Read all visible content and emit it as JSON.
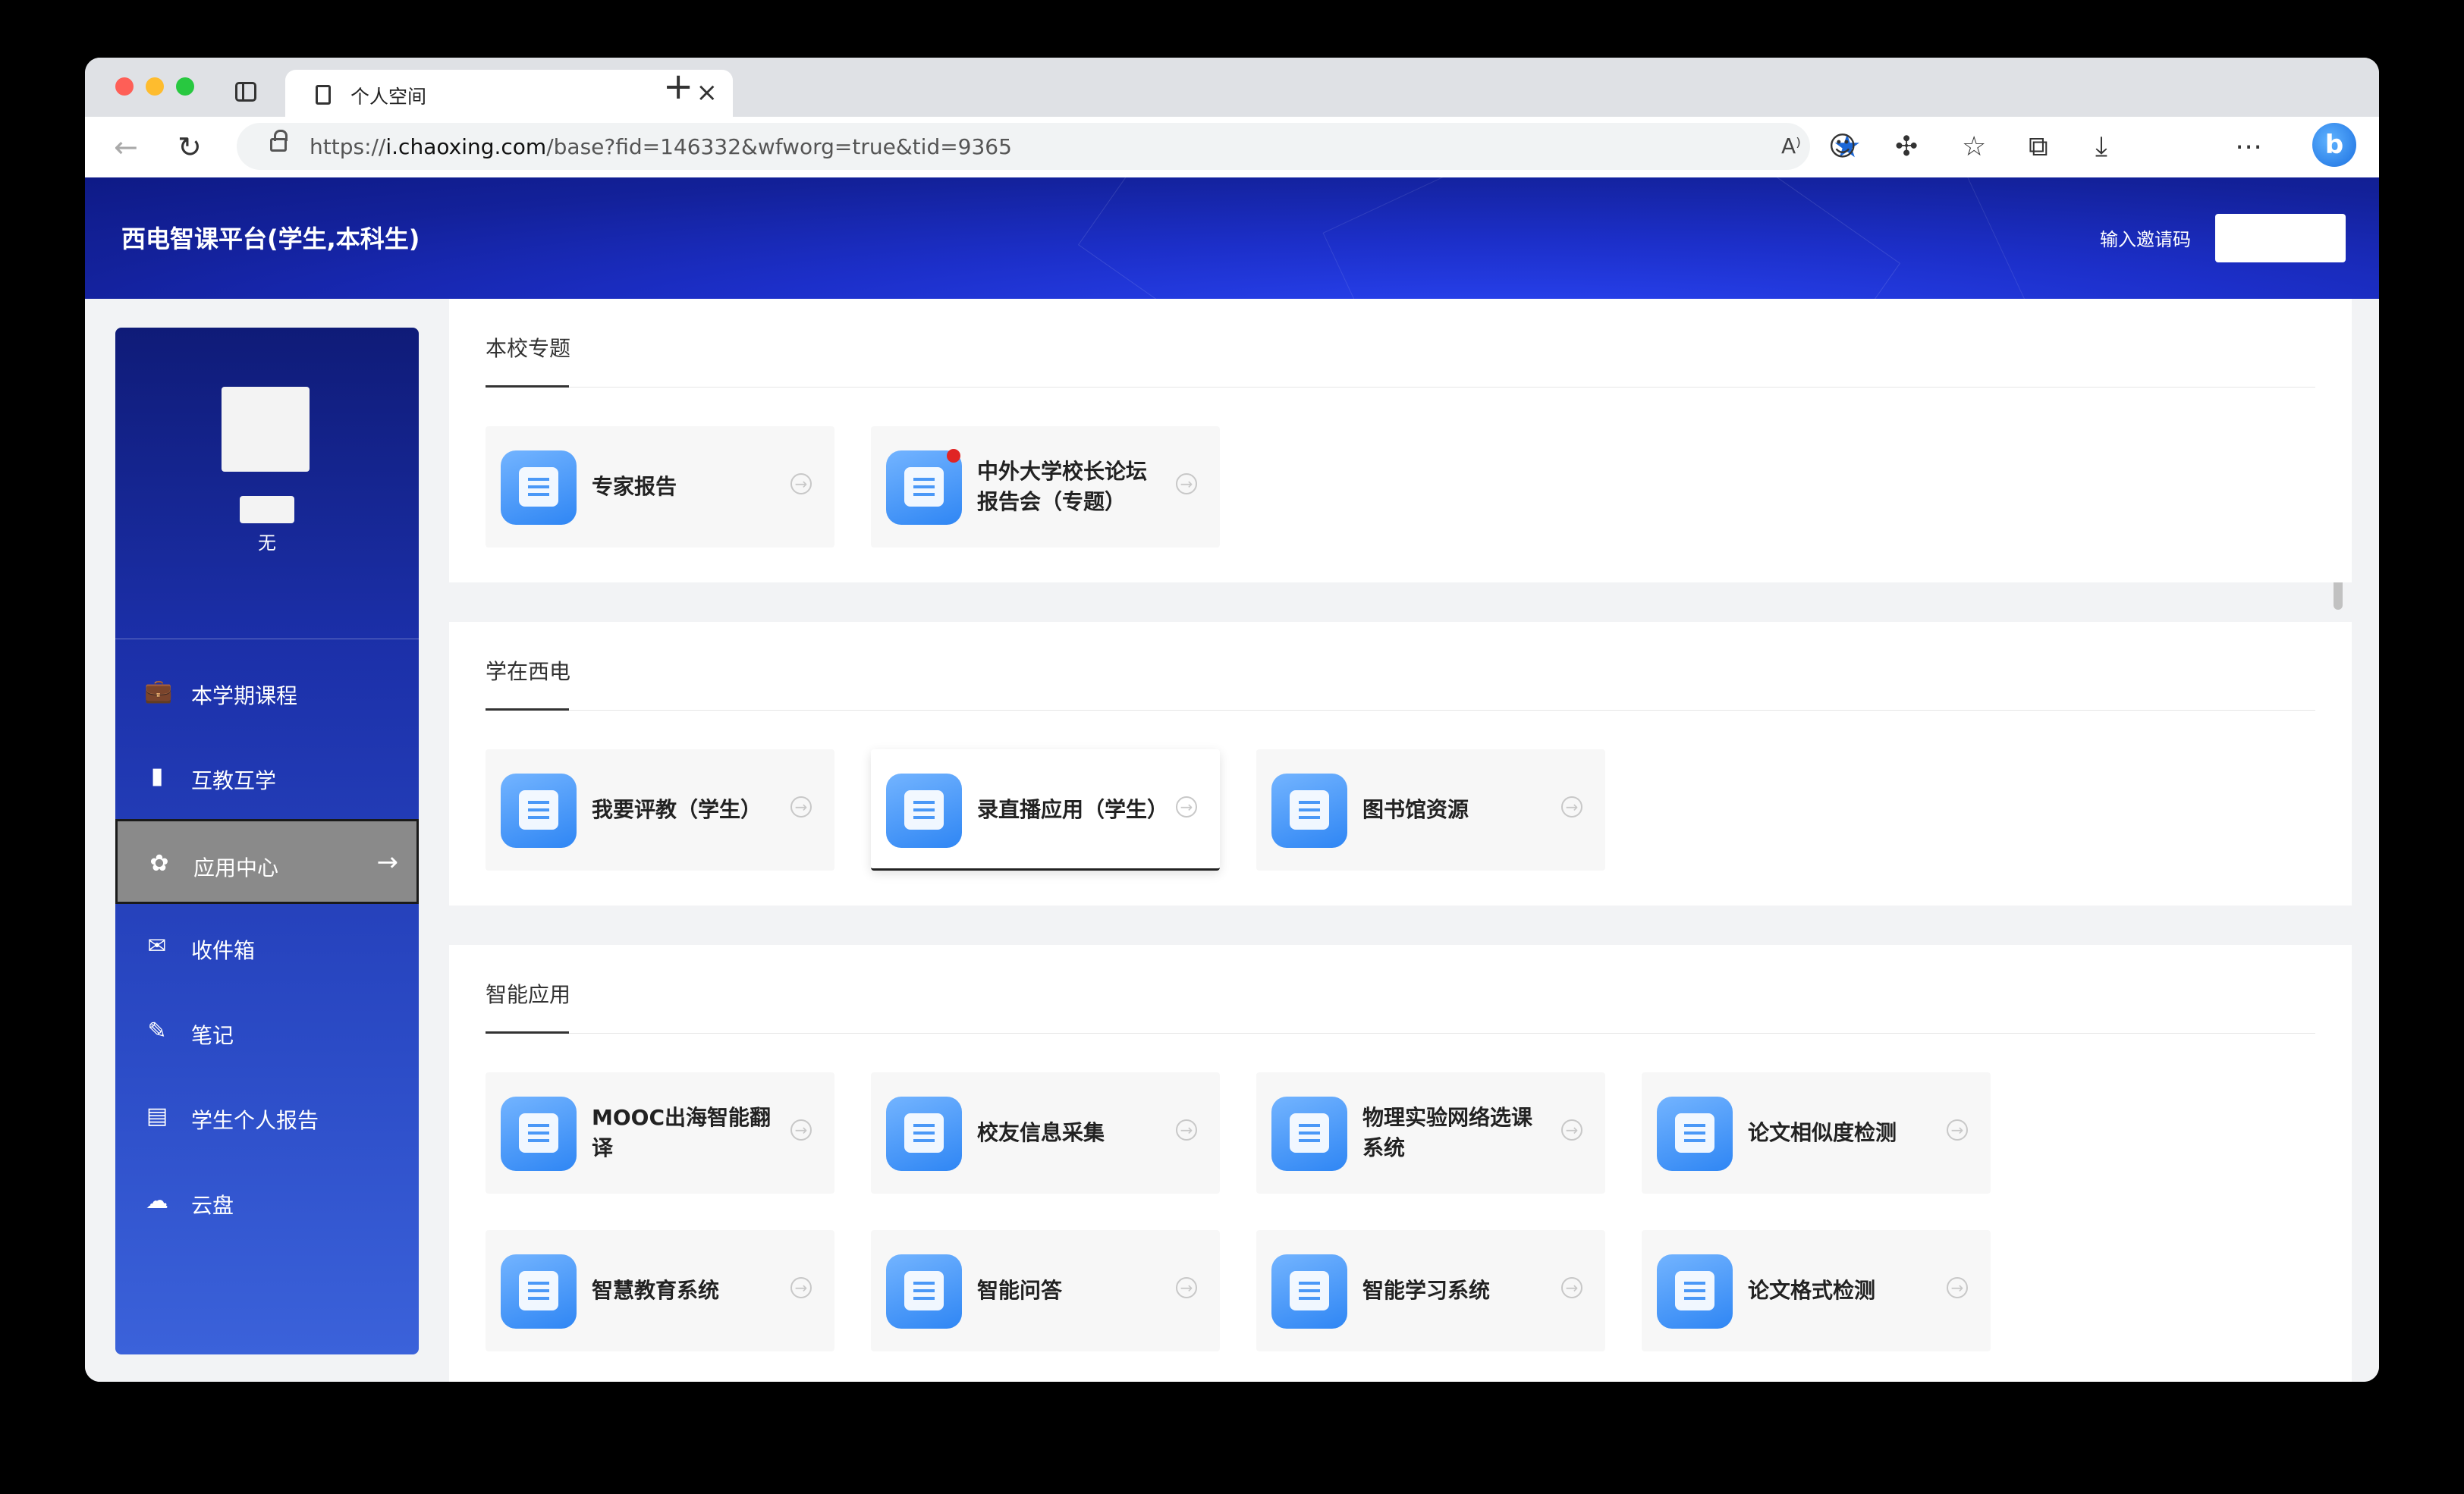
{
  "browser": {
    "tab_title": "个人空间",
    "url_prefix": "https://",
    "url_host": "i.chaoxing.com",
    "url_path": "/base?fid=146332&wfworg=true&tid=9365"
  },
  "header": {
    "site_title": "西电智课平台(学生,本科生)",
    "invite_label": "输入邀请码",
    "invite_value": ""
  },
  "profile": {
    "name": "",
    "subtitle": "无"
  },
  "menu": {
    "items": [
      {
        "label": "本学期课程",
        "icon": "briefcase-icon"
      },
      {
        "label": "互教互学",
        "icon": "book-icon"
      },
      {
        "label": "应用中心",
        "icon": "apps-icon",
        "active": true
      },
      {
        "label": "收件箱",
        "icon": "mail-icon"
      },
      {
        "label": "笔记",
        "icon": "note-icon"
      },
      {
        "label": "学生个人报告",
        "icon": "report-icon"
      },
      {
        "label": "云盘",
        "icon": "cloud-icon"
      }
    ]
  },
  "sections": [
    {
      "title": "本校专题",
      "cards": [
        {
          "label": "专家报告",
          "icon": "chart-board-icon"
        },
        {
          "label": "中外大学校长论坛报告会（专题）",
          "icon": "presentation-icon",
          "badge": true
        }
      ]
    },
    {
      "title": "学在西电",
      "cards": [
        {
          "label": "我要评教（学生）",
          "icon": "document-icon"
        },
        {
          "label": "录直播应用（学生）",
          "icon": "video-icon",
          "hovered": true
        },
        {
          "label": "图书馆资源",
          "icon": "library-icon"
        }
      ]
    },
    {
      "title": "智能应用",
      "cards": [
        {
          "label": "MOOC出海智能翻译",
          "icon": "translate-icon"
        },
        {
          "label": "校友信息采集",
          "icon": "clipboard-icon"
        },
        {
          "label": "物理实验网络选课系统",
          "icon": "monitor-icon"
        },
        {
          "label": "论文相似度检测",
          "icon": "paper-search-icon"
        },
        {
          "label": "智慧教育系统",
          "icon": "teacher-icon"
        },
        {
          "label": "智能问答",
          "icon": "question-icon"
        },
        {
          "label": "智能学习系统",
          "icon": "desktop-icon"
        },
        {
          "label": "论文格式检测",
          "icon": "paper-check-icon"
        }
      ]
    }
  ]
}
